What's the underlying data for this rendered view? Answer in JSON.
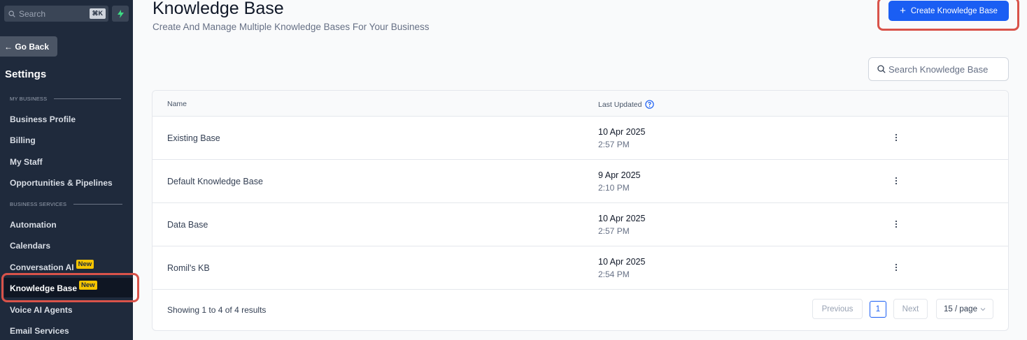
{
  "sidebar": {
    "search_placeholder": "Search",
    "search_shortcut": "⌘K",
    "go_back": "← Go Back",
    "settings_title": "Settings",
    "section_my_business": "MY BUSINESS",
    "section_business_services": "BUSINESS SERVICES",
    "items": [
      {
        "label": "Business Profile"
      },
      {
        "label": "Billing"
      },
      {
        "label": "My Staff"
      },
      {
        "label": "Opportunities & Pipelines"
      },
      {
        "label": "Automation"
      },
      {
        "label": "Calendars"
      },
      {
        "label": "Conversation AI",
        "badge": "New"
      },
      {
        "label": "Knowledge Base",
        "badge": "New"
      },
      {
        "label": "Voice AI Agents"
      },
      {
        "label": "Email Services"
      }
    ]
  },
  "header": {
    "title": "Knowledge Base",
    "subtitle": "Create And Manage Multiple Knowledge Bases For Your Business",
    "create_button": "Create Knowledge Base",
    "create_button_icon": "+"
  },
  "search": {
    "placeholder": "Search Knowledge Base"
  },
  "table": {
    "columns": [
      "Name",
      "Last Updated"
    ],
    "rows": [
      {
        "name": "Existing Base",
        "date": "10 Apr 2025",
        "time": "2:57 PM"
      },
      {
        "name": "Default Knowledge Base",
        "date": "9 Apr 2025",
        "time": "2:10 PM"
      },
      {
        "name": "Data Base",
        "date": "10 Apr 2025",
        "time": "2:57 PM"
      },
      {
        "name": "Romil's KB",
        "date": "10 Apr 2025",
        "time": "2:54 PM"
      }
    ]
  },
  "pagination": {
    "summary": "Showing 1 to 4 of 4 results",
    "previous": "Previous",
    "current_page": "1",
    "next": "Next",
    "per_page": "15 / page"
  },
  "colors": {
    "sidebar_bg": "#1f2a3c",
    "accent": "#1a5ef3",
    "badge": "#f5c400",
    "highlight_outline": "#d9534a"
  }
}
